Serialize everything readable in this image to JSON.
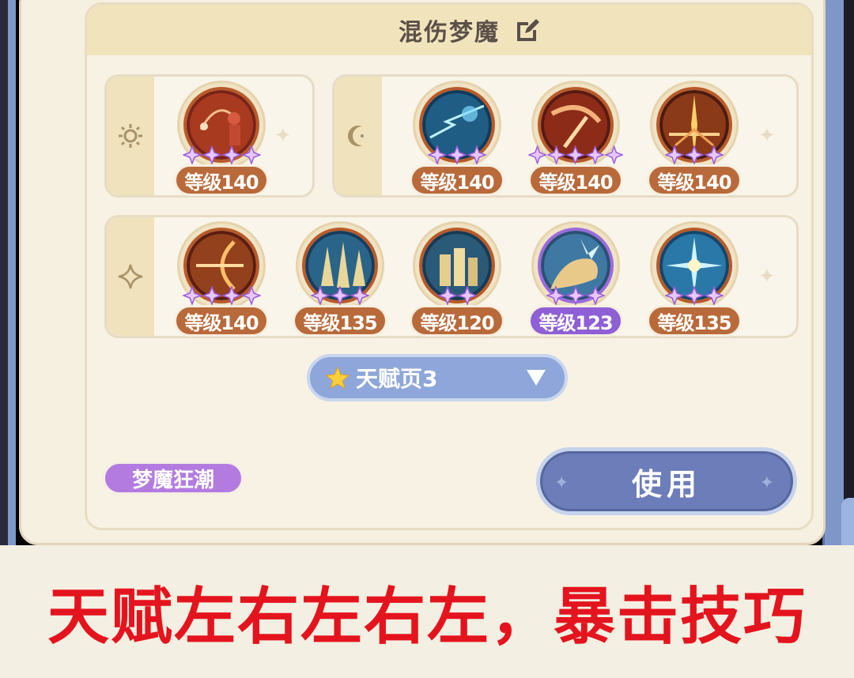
{
  "header": {
    "title": "混伤梦魔"
  },
  "groups": [
    {
      "symbol": "sun-icon",
      "skills": [
        {
          "level": "等级140",
          "stars": 4,
          "theme": "red",
          "icon": "archer-icon"
        }
      ]
    },
    {
      "symbol": "moon-icon",
      "skills": [
        {
          "level": "等级140",
          "stars": 3,
          "theme": "blue",
          "icon": "lightning-icon"
        },
        {
          "level": "等级140",
          "stars": 5,
          "theme": "red",
          "icon": "slash-icon"
        },
        {
          "level": "等级140",
          "stars": 3,
          "theme": "red",
          "icon": "burst-icon"
        }
      ]
    },
    {
      "symbol": "sparkle-icon",
      "skills": [
        {
          "level": "等级140",
          "stars": 4,
          "theme": "red",
          "icon": "crossbow-icon"
        },
        {
          "level": "等级135",
          "stars": 3,
          "theme": "blue",
          "icon": "spikes-icon"
        },
        {
          "level": "等级120",
          "stars": 2,
          "theme": "blue",
          "icon": "fortress-icon"
        },
        {
          "level": "等级123",
          "stars": 3,
          "theme": "purple",
          "icon": "beast-icon"
        },
        {
          "level": "等级135",
          "stars": 3,
          "theme": "blue",
          "icon": "frost-icon"
        }
      ]
    }
  ],
  "page_selector": {
    "label": "天赋页3",
    "icon": "star-icon"
  },
  "tag": {
    "label": "梦魔狂潮"
  },
  "use_button": {
    "label": "使用"
  },
  "caption": {
    "text": "天赋左右左右左，暴击技巧"
  },
  "colors": {
    "accent_blue": "#8ea6d9",
    "level_brown": "#b96a3a",
    "level_purple": "#8f5fd6",
    "caption_red": "#e4141e"
  }
}
